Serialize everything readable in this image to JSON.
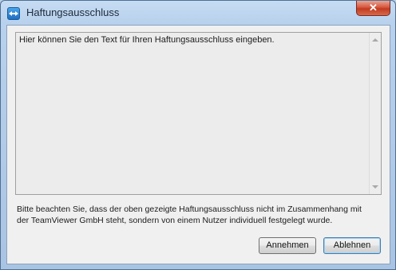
{
  "window": {
    "title": "Haftungsausschluss",
    "close_label": "✕"
  },
  "textbox": {
    "value": "Hier können Sie den Text für Ihren Haftungsausschluss eingeben."
  },
  "notice": {
    "line1": "Bitte beachten Sie, dass der oben gezeigte Haftungsausschluss nicht im Zusammenhang mit",
    "line2": "der TeamViewer GmbH steht, sondern von einem Nutzer individuell festgelegt wurde."
  },
  "buttons": {
    "accept_label": "Annehmen",
    "decline_label": "Ablehnen"
  },
  "icons": {
    "app": "teamviewer-icon",
    "close": "close-icon",
    "scroll_up": "scroll-up-arrow-icon",
    "scroll_down": "scroll-down-arrow-icon"
  }
}
